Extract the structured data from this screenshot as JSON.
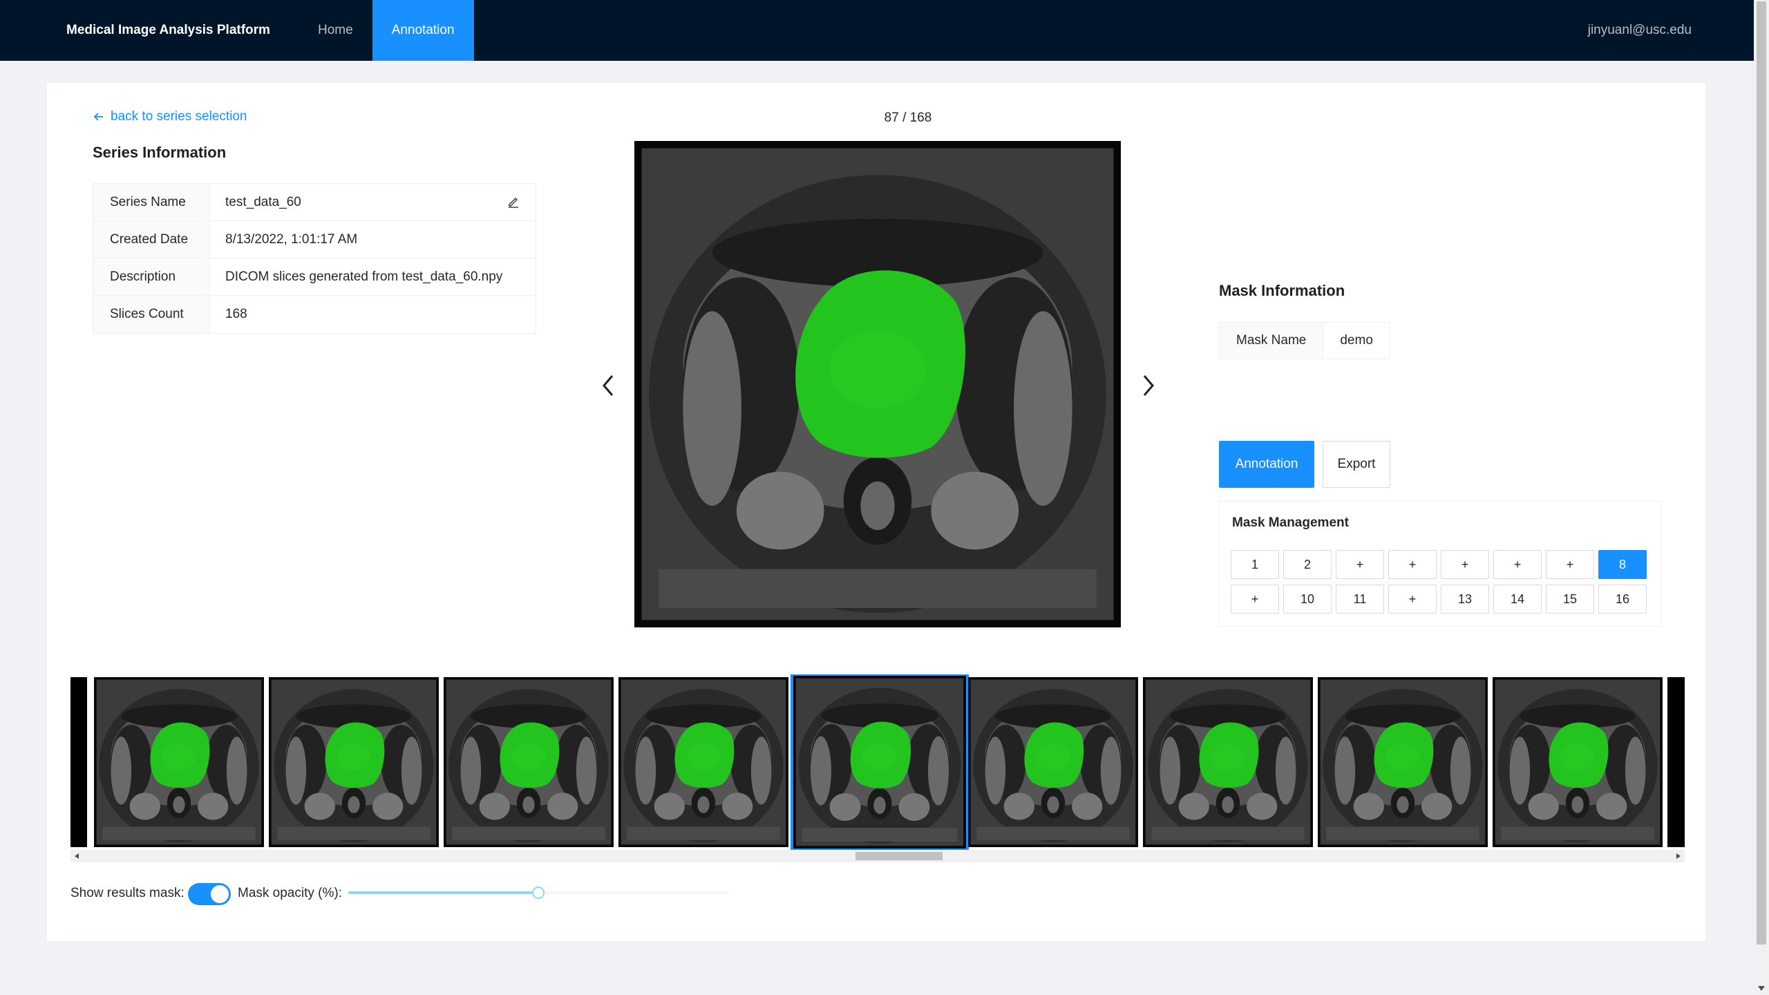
{
  "header": {
    "brand": "Medical Image Analysis Platform",
    "nav": [
      "Home",
      "Annotation"
    ],
    "active_nav": "Annotation",
    "user": "jinyuanl@usc.edu"
  },
  "back_link": "back to series selection",
  "series_info": {
    "title": "Series Information",
    "rows": [
      {
        "label": "Series Name",
        "value": "test_data_60"
      },
      {
        "label": "Created Date",
        "value": "8/13/2022, 1:01:17 AM"
      },
      {
        "label": "Description",
        "value": "DICOM slices generated from test_data_60.npy"
      },
      {
        "label": "Slices Count",
        "value": "168"
      }
    ]
  },
  "viewer": {
    "counter": "87 / 168",
    "mask_color": "#22c41d"
  },
  "mask_info": {
    "title": "Mask Information",
    "label": "Mask Name",
    "value": "demo"
  },
  "buttons": {
    "annotation": "Annotation",
    "export": "Export"
  },
  "mask_management": {
    "title": "Mask Management",
    "cells": [
      "1",
      "2",
      "+",
      "+",
      "+",
      "+",
      "+",
      "8",
      "+",
      "10",
      "11",
      "+",
      "13",
      "14",
      "15",
      "16"
    ],
    "active": "8"
  },
  "thumbnails": {
    "count": 9,
    "selected_index": 4
  },
  "controls": {
    "show_mask_label": "Show results mask:",
    "show_mask_on": true,
    "opacity_label": "Mask opacity (%):",
    "opacity": 50
  },
  "accent_color": "#1890ff",
  "header_color": "#001529"
}
